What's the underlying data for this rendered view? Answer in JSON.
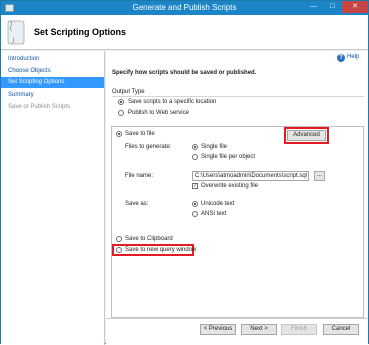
{
  "window": {
    "title": "Generate and Publish Scripts",
    "minimize_glyph": "—",
    "maximize_glyph": "□",
    "close_glyph": "✕"
  },
  "header": {
    "title": "Set Scripting Options",
    "icon": "scroll-icon"
  },
  "sidebar": {
    "items": [
      {
        "label": "Introduction",
        "state": "link"
      },
      {
        "label": "Choose Objects",
        "state": "link"
      },
      {
        "label": "Set Scripting Options",
        "state": "active"
      },
      {
        "label": "Summary",
        "state": "link"
      },
      {
        "label": "Save or Publish Scripts",
        "state": "disabled"
      }
    ]
  },
  "help": {
    "label": "Help",
    "icon": "help-icon"
  },
  "main": {
    "intro": "Specify how scripts should be saved or published.",
    "output_type": {
      "label": "Output Type",
      "options": [
        {
          "label": "Save scripts to a specific location",
          "selected": true
        },
        {
          "label": "Publish to Web service",
          "selected": false
        }
      ]
    },
    "save_to_file": {
      "label": "Save to file",
      "selected": true,
      "advanced_button": "Advanced",
      "files_to_generate_label": "Files to generate:",
      "files_options": [
        {
          "label": "Single file",
          "selected": true
        },
        {
          "label": "Single file per object",
          "selected": false
        }
      ],
      "file_name_label": "File name:",
      "file_name_value": "C:\\Users\\atmoadmin\\Documents\\script.sql",
      "browse_label": "...",
      "overwrite_label": "Overwrite existing file",
      "overwrite_checked": true,
      "save_as_label": "Save as:",
      "save_as_options": [
        {
          "label": "Unicode text",
          "selected": true
        },
        {
          "label": "ANSI text",
          "selected": false
        }
      ]
    },
    "save_to_clipboard": {
      "label": "Save to Clipboard",
      "selected": false
    },
    "save_to_query_window": {
      "label": "Save to new query window",
      "selected": false
    }
  },
  "footer": {
    "previous": "< Previous",
    "next": "Next >",
    "finish": "Finish",
    "cancel": "Cancel"
  },
  "colors": {
    "titlebar": "#1c85c8",
    "active_nav": "#3399ff",
    "highlight": "#e31b23"
  }
}
